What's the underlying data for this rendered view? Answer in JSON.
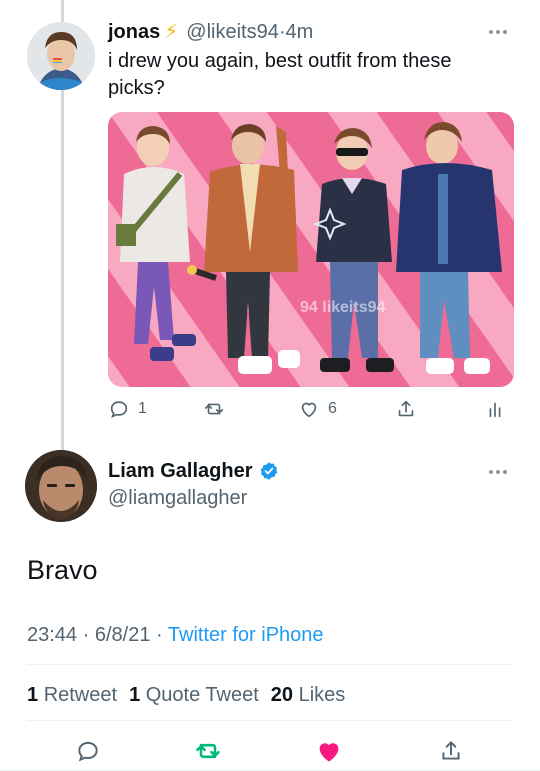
{
  "parent_tweet": {
    "name": "jonas",
    "name_emoji": "⚡",
    "handle": "@likeits94",
    "dot": "·",
    "time": "4m",
    "text": "i drew you again, best outfit from these picks?",
    "media_watermark": "94 likeits94",
    "actions": {
      "reply_count": "1",
      "retweet_count": "",
      "like_count": "6"
    }
  },
  "main_tweet": {
    "name": "Liam Gallagher",
    "handle": "@liamgallagher",
    "text": "Bravo",
    "time": "23:44",
    "sep1": "·",
    "date": "6/8/21",
    "sep2": "·",
    "source": "Twitter for iPhone",
    "stats": {
      "retweets_count": "1",
      "retweets_label": "Retweet",
      "quotes_count": "1",
      "quotes_label": "Quote Tweet",
      "likes_count": "20",
      "likes_label": "Likes"
    }
  },
  "colors": {
    "accent": "#1d9bf0",
    "retweet_active": "#00ba7c",
    "like_active": "#f91880",
    "muted": "#536471",
    "media_bg": "#ee6b95",
    "media_stripe": "#f8a9c1"
  },
  "icons": {
    "reply": "reply-icon",
    "retweet": "retweet-icon",
    "like": "heart-icon",
    "share": "share-icon",
    "analytics": "analytics-icon",
    "more": "more-icon",
    "verified": "verified-badge-icon"
  }
}
